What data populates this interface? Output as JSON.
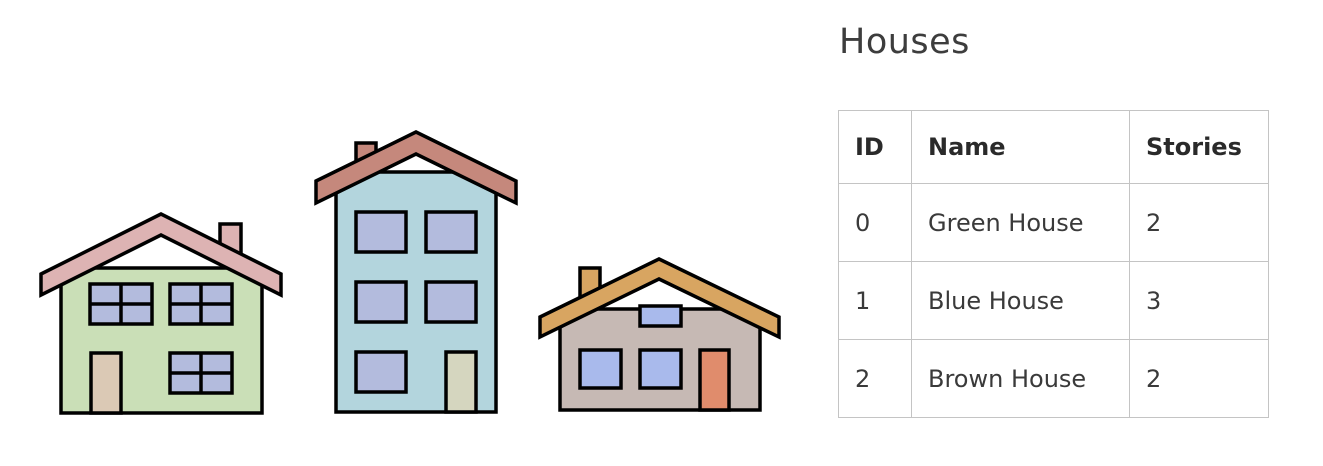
{
  "title": "Houses",
  "table": {
    "headers": {
      "id": "ID",
      "name": "Name",
      "stories": "Stories"
    },
    "rows": [
      {
        "id": "0",
        "name": "Green House",
        "stories": "2"
      },
      {
        "id": "1",
        "name": "Blue House",
        "stories": "3"
      },
      {
        "id": "2",
        "name": "Brown House",
        "stories": "2"
      }
    ]
  },
  "houses": [
    {
      "name": "green-house",
      "wall": "#cadfb7",
      "roof": "#ddb3b3",
      "window": "#b3bbdd",
      "door": "#dbc9b5",
      "stories": 2
    },
    {
      "name": "blue-house",
      "wall": "#b3d5dd",
      "roof": "#c5887c",
      "window": "#b3bbdd",
      "door": "#d5d6bf",
      "stories": 3
    },
    {
      "name": "brown-house",
      "wall": "#c6b9b4",
      "roof": "#d8a561",
      "window": "#a9baec",
      "door": "#e08c6c",
      "stories": 2
    }
  ]
}
